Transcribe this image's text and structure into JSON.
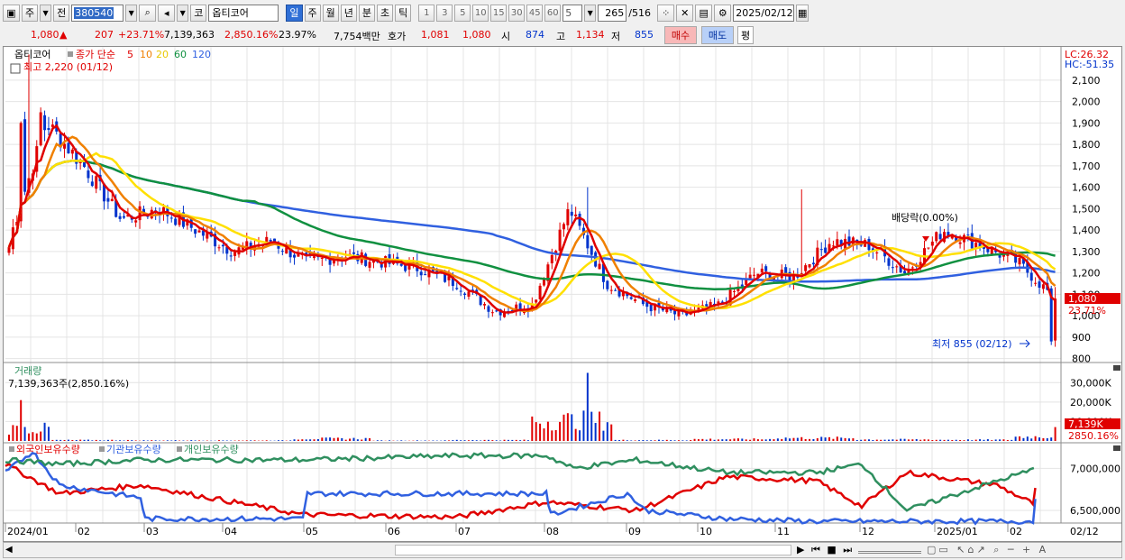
{
  "toolbar": {
    "period_label": "주",
    "prev_label": "전",
    "code": "380540",
    "market_label": "코",
    "stock_name": "옵티코어",
    "tabs": [
      "일",
      "주",
      "월",
      "년",
      "분",
      "초",
      "틱"
    ],
    "active_tab": "일",
    "intervals": [
      "1",
      "3",
      "5",
      "10",
      "15",
      "30",
      "45",
      "60"
    ],
    "count_value": "5",
    "bars_shown": "265",
    "bars_total": "/516",
    "date": "2025/02/12"
  },
  "quote": {
    "price": "1,080",
    "arrow": "▲",
    "change": "207",
    "change_pct": "+23.71%",
    "volume": "7,139,363",
    "vol_ratio": "2,850.16%",
    "turnover": "23.97%",
    "amount": "7,754백만",
    "hoga_label": "호가",
    "ask": "1,081",
    "bid": "1,080",
    "open_label": "시",
    "open": "874",
    "high_label": "고",
    "high": "1,134",
    "low_label": "저",
    "low": "855",
    "buy_label": "매수",
    "sell_label": "매도",
    "eval_label": "평"
  },
  "colors": {
    "up": "#e00000",
    "down": "#0033cc",
    "ma5": "#e00000",
    "ma10": "#f08000",
    "ma20": "#ffe000",
    "ma60": "#109040",
    "ma120": "#3060e0",
    "foreign": "#e00000",
    "institution": "#3060e0",
    "individual": "#2f8f5f"
  },
  "chart_data": [
    {
      "type": "line",
      "panel": "price",
      "legend": {
        "name": "옵티코어",
        "ma_title": "종가 단순",
        "ma_periods": [
          "5",
          "10",
          "20",
          "60",
          "120"
        ]
      },
      "right_labels": {
        "lc": "LC:26.32",
        "hc": "HC:-51.35"
      },
      "y_ticks": [
        "2,100",
        "2,000",
        "1,900",
        "1,800",
        "1,700",
        "1,600",
        "1,500",
        "1,400",
        "1,300",
        "1,200",
        "1,100",
        "1,000",
        "900",
        "800"
      ],
      "ylim": [
        790,
        2230
      ],
      "current_price_label": "1,080",
      "current_pct_label": "23.71%",
      "annotations": {
        "high": "최고 2,220 (01/12)",
        "low": "최저 855 (02/12)",
        "dividend": "배당락(0.00%)"
      },
      "x_ticks": [
        "2024/01",
        "02",
        "03",
        "04",
        "05",
        "06",
        "07",
        "08",
        "09",
        "10",
        "11",
        "12",
        "2025/01",
        "02",
        "02/12"
      ],
      "series": [
        {
          "name": "종가",
          "x": [
            "2024-01",
            "2024-01",
            "2024-01",
            "2024-02",
            "2024-02",
            "2024-03",
            "2024-03",
            "2024-04",
            "2024-04",
            "2024-05",
            "2024-05",
            "2024-06",
            "2024-06",
            "2024-07",
            "2024-07",
            "2024-08",
            "2024-08",
            "2024-09",
            "2024-09",
            "2024-10",
            "2024-10",
            "2024-11",
            "2024-11",
            "2024-12",
            "2024-12",
            "2025-01",
            "2025-01",
            "2025-02",
            "2025-02"
          ],
          "values": [
            1350,
            1900,
            1700,
            1450,
            1500,
            1400,
            1300,
            1350,
            1250,
            1280,
            1250,
            1220,
            1150,
            1020,
            1050,
            1500,
            1150,
            1050,
            1000,
            1050,
            1200,
            1180,
            1350,
            1330,
            1200,
            1400,
            1330,
            1250,
            1080
          ]
        },
        {
          "name": "MA120",
          "x": [
            "2024-01",
            "2024-03",
            "2024-05",
            "2024-07",
            "2024-08",
            "2024-10",
            "2024-12",
            "2025-02"
          ],
          "values": [
            1370,
            1420,
            1420,
            1380,
            1250,
            1160,
            1150,
            1170
          ]
        }
      ]
    },
    {
      "type": "bar",
      "panel": "volume",
      "title": "거래량",
      "value_label": "7,139,363주(2,850.16%)",
      "y_ticks": [
        "30,000K",
        "20,000K",
        "10,000K"
      ],
      "current_label": "7,139K",
      "current_pct_label": "2850.16%",
      "x": [
        "2024-01",
        "2024-02",
        "2024-03",
        "2024-04",
        "2024-05",
        "2024-06",
        "2024-07",
        "2024-08",
        "2024-09",
        "2024-10",
        "2024-11",
        "2024-12",
        "2025-01",
        "2025-02"
      ],
      "values": [
        21000,
        1500,
        1000,
        900,
        4000,
        800,
        1500,
        35000,
        1500,
        3000,
        5000,
        2500,
        2000,
        7139
      ]
    },
    {
      "type": "line",
      "panel": "holdings",
      "series_labels": [
        "외국인보유수량",
        "기관보유수량",
        "개인보유수량"
      ],
      "y_ticks": [
        "7,000,000",
        "6,500,000"
      ]
    }
  ]
}
